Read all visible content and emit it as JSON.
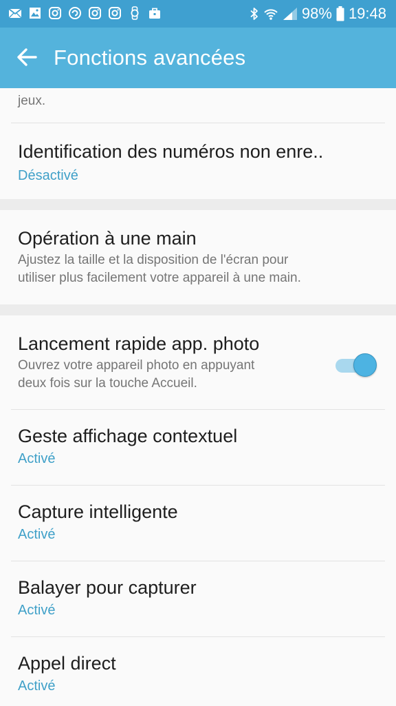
{
  "status_bar": {
    "notification_icons": [
      "mail-icon",
      "gallery-icon",
      "instagram-icon",
      "sync-icon",
      "instagram-icon",
      "instagram-icon",
      "watch-icon",
      "briefcase-icon"
    ],
    "battery_percent": "98%",
    "time": "19:48"
  },
  "app_bar": {
    "title": "Fonctions avancées"
  },
  "settings": {
    "partial_desc": "jeux.",
    "caller_id": {
      "title": "Identification des numéros non enre..",
      "status": "Désactivé"
    },
    "one_hand": {
      "title": "Opération à une main",
      "desc_line1": "Ajustez la taille et la disposition de l'écran pour",
      "desc_line2": "utiliser plus facilement votre appareil à une main."
    },
    "quick_camera": {
      "title": "Lancement rapide app. photo",
      "desc_line1": "Ouvrez votre appareil photo en appuyant",
      "desc_line2": "deux fois sur la touche Accueil.",
      "enabled": true
    },
    "popup_gesture": {
      "title": "Geste affichage contextuel",
      "status": "Activé"
    },
    "smart_capture": {
      "title": "Capture intelligente",
      "status": "Activé"
    },
    "palm_swipe": {
      "title": "Balayer pour capturer",
      "status": "Activé"
    },
    "direct_call": {
      "title": "Appel direct",
      "status": "Activé"
    }
  },
  "colors": {
    "status_bar": "#3fa0d0",
    "app_bar": "#54b3dc",
    "accent": "#3fa0c8",
    "toggle_on": "#4db3e2"
  }
}
